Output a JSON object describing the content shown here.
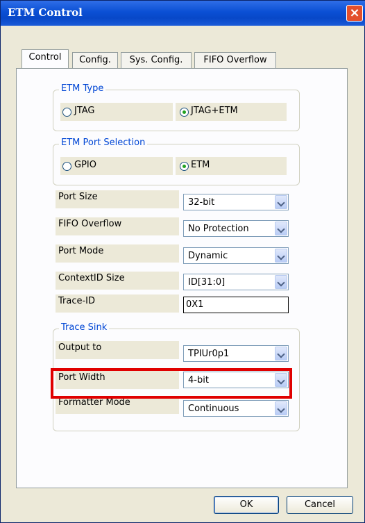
{
  "window": {
    "title": "ETM Control",
    "close_label": "×"
  },
  "tabs": [
    "Control",
    "Config.",
    "Sys. Config.",
    "FIFO Overflow"
  ],
  "etm_type": {
    "label": "ETM Type",
    "options": [
      "JTAG",
      "JTAG+ETM"
    ],
    "selected": "JTAG+ETM"
  },
  "etm_port": {
    "label": "ETM Port Selection",
    "options": [
      "GPIO",
      "ETM"
    ],
    "selected": "ETM"
  },
  "fields": [
    {
      "label": "Port Size",
      "value": "32-bit"
    },
    {
      "label": "FIFO Overflow",
      "value": "No Protection"
    },
    {
      "label": "Port Mode",
      "value": "Dynamic"
    },
    {
      "label": "ContextID Size",
      "value": "ID[31:0]"
    }
  ],
  "trace_id": {
    "label": "Trace-ID",
    "value": "0X1"
  },
  "trace_sink": {
    "label": "Trace Sink",
    "fields": [
      {
        "label": "Output to",
        "value": "TPIUr0p1"
      },
      {
        "label": "Port Width",
        "value": "4-bit"
      },
      {
        "label": "Formatter Mode",
        "value": "Continuous"
      }
    ]
  },
  "buttons": {
    "ok": "OK",
    "cancel": "Cancel"
  },
  "colors": {
    "highlight": "#e00000",
    "group_label": "#0046d5"
  }
}
